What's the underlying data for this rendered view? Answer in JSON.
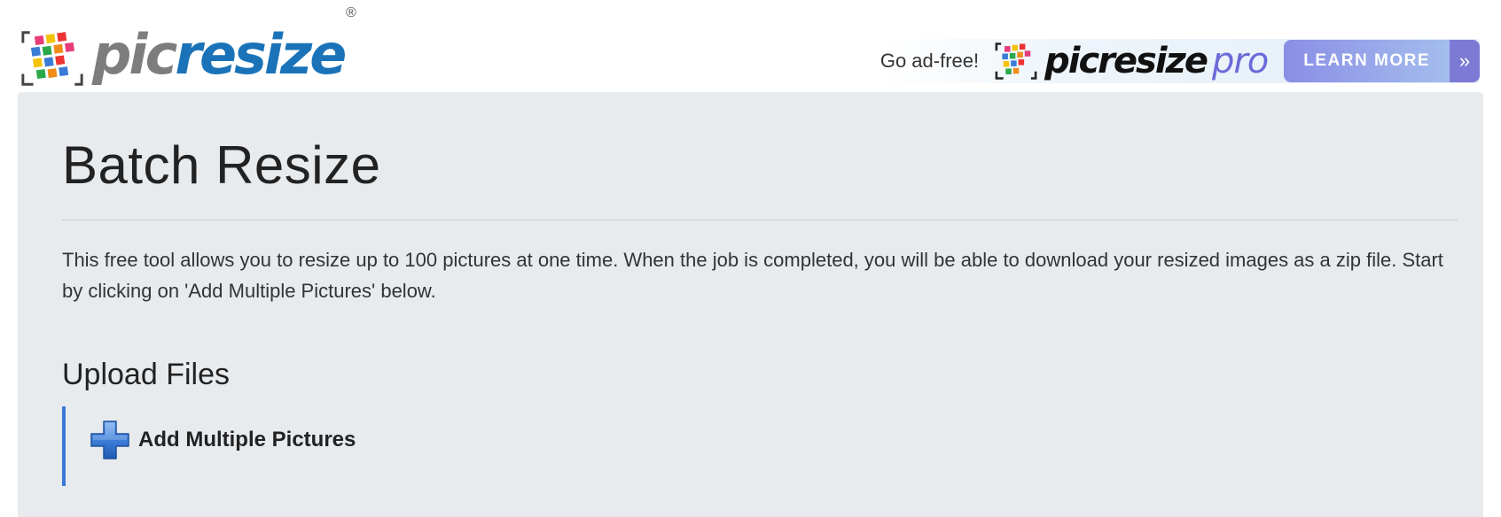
{
  "header": {
    "logo": {
      "part1": "pic",
      "part2": "resize",
      "registered": "®"
    },
    "promo": {
      "text": "Go ad-free!",
      "brand": "picresize",
      "brand_suffix": "pro",
      "button_label": "LEARN MORE",
      "button_arrow": "»"
    }
  },
  "main": {
    "title": "Batch Resize",
    "intro": "This free tool allows you to resize up to 100 pictures at one time. When the job is completed, you will be able to download your resized images as a zip file. Start by clicking on 'Add Multiple Pictures' below.",
    "upload": {
      "section_title": "Upload Files",
      "add_button_label": "Add Multiple Pictures",
      "add_icon": "plus-icon"
    }
  },
  "colors": {
    "accent_blue": "#1a73b8",
    "panel_bg": "#e8ebee",
    "upload_border": "#3b78d8",
    "pro_purple": "#6b6ad8"
  }
}
